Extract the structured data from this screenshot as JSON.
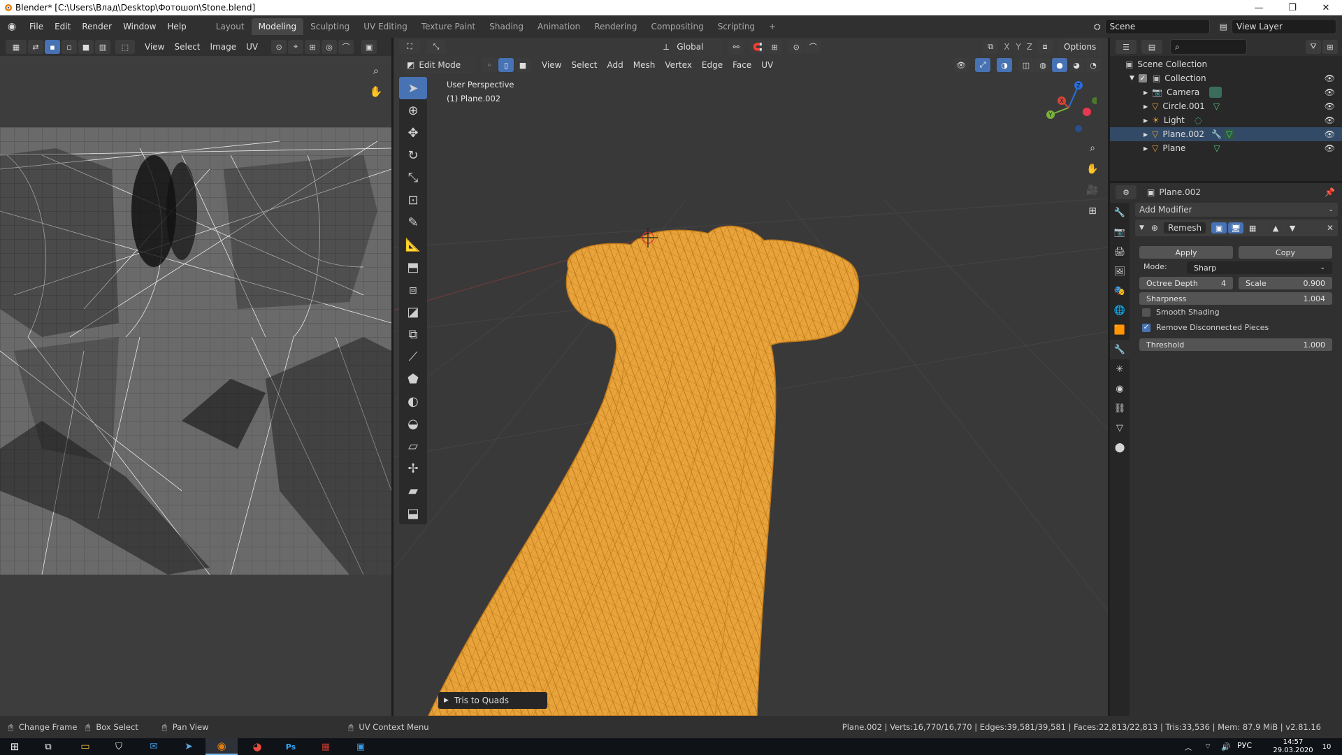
{
  "window": {
    "title": "Blender* [C:\\Users\\Влад\\Desktop\\Фотошоп\\Stone.blend]"
  },
  "topmenu": {
    "items": [
      "File",
      "Edit",
      "Render",
      "Window",
      "Help"
    ],
    "workspaces": [
      "Layout",
      "Modeling",
      "Sculpting",
      "UV Editing",
      "Texture Paint",
      "Shading",
      "Animation",
      "Rendering",
      "Compositing",
      "Scripting"
    ],
    "active_workspace": "Modeling",
    "add_tab": "+",
    "scene": "Scene",
    "view_layer": "View Layer"
  },
  "uv_editor": {
    "menus": [
      "View",
      "Select",
      "Image",
      "UV"
    ]
  },
  "viewport": {
    "mode": "Edit Mode",
    "menus": [
      "View",
      "Select",
      "Add",
      "Mesh",
      "Vertex",
      "Edge",
      "Face",
      "UV"
    ],
    "orientation": "Global",
    "options": "Options",
    "overlay_title": "User Perspective",
    "overlay_object": "(1) Plane.002",
    "last_operation": "Tris to Quads",
    "mesh_color": "#e8a33a",
    "axis_labels": {
      "x": "X",
      "y": "Y",
      "z": "Z"
    }
  },
  "outliner": {
    "root": "Scene Collection",
    "collection": "Collection",
    "items": [
      {
        "name": "Camera",
        "icon": "camera-icon"
      },
      {
        "name": "Circle.001",
        "icon": "mesh-icon"
      },
      {
        "name": "Light",
        "icon": "light-icon"
      },
      {
        "name": "Plane.002",
        "icon": "mesh-icon"
      },
      {
        "name": "Plane",
        "icon": "mesh-icon"
      }
    ]
  },
  "properties": {
    "object_name": "Plane.002",
    "add_modifier": "Add Modifier",
    "modifier_name": "Remesh",
    "apply": "Apply",
    "copy": "Copy",
    "mode_label": "Mode:",
    "mode_value": "Sharp",
    "octree_label": "Octree Depth",
    "octree_value": "4",
    "scale_label": "Scale",
    "scale_value": "0.900",
    "sharpness_label": "Sharpness",
    "sharpness_value": "1.004",
    "smooth_shading": "Smooth Shading",
    "smooth_checked": false,
    "remove_disconnected": "Remove Disconnected Pieces",
    "remove_checked": true,
    "threshold_label": "Threshold",
    "threshold_value": "1.000"
  },
  "statusbar": {
    "change_frame": "Change Frame",
    "box_select": "Box Select",
    "pan_view": "Pan View",
    "uv_context": "UV Context Menu",
    "stats": "Plane.002 | Verts:16,770/16,770 | Edges:39,581/39,581 | Faces:22,813/22,813 | Tris:33,536 | Mem: 87.9 MiB | v2.81.16"
  },
  "taskbar": {
    "lang": "РУС",
    "time": "14:57",
    "date": "29.03.2020",
    "notif": "10"
  }
}
